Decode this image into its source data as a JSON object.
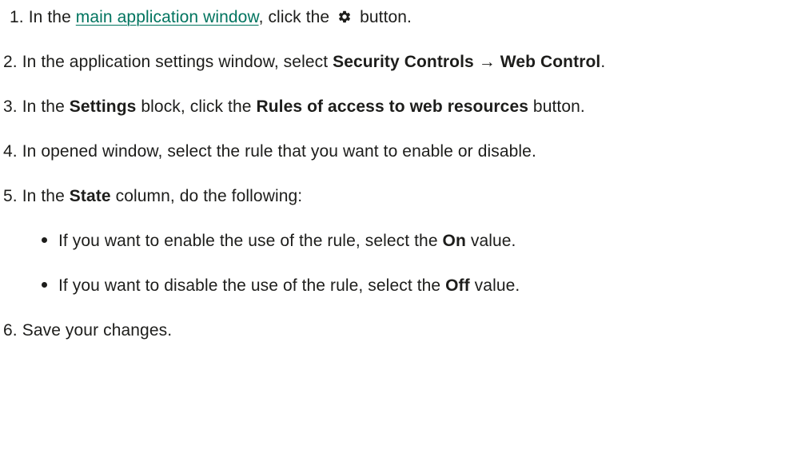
{
  "steps": [
    {
      "number": "1.",
      "before": "In the ",
      "link": "main application window",
      "middle": ", click the ",
      "icon": "gear-icon",
      "after": " button."
    },
    {
      "number": "2.",
      "before": "In the application settings window, select ",
      "bold1": "Security Controls → Web Control",
      "after": "."
    },
    {
      "number": "3.",
      "before": "In the ",
      "bold1": "Settings",
      "middle": " block, click the ",
      "bold2": "Rules of access to web resources",
      "after": " button."
    },
    {
      "number": "4.",
      "text": "In opened window, select the rule that you want to enable or disable."
    },
    {
      "number": "5.",
      "before": "In the ",
      "bold1": "State",
      "after": " column, do the following:"
    },
    {
      "number": "6.",
      "text": "Save your changes."
    }
  ],
  "bullets": [
    {
      "before": "If you want to enable the use of the rule, select the ",
      "bold": "On",
      "after": " value."
    },
    {
      "before": "If you want to disable the use of the rule, select the ",
      "bold": "Off",
      "after": " value."
    }
  ],
  "colors": {
    "text": "#1d1d1b",
    "link": "#00745f"
  }
}
